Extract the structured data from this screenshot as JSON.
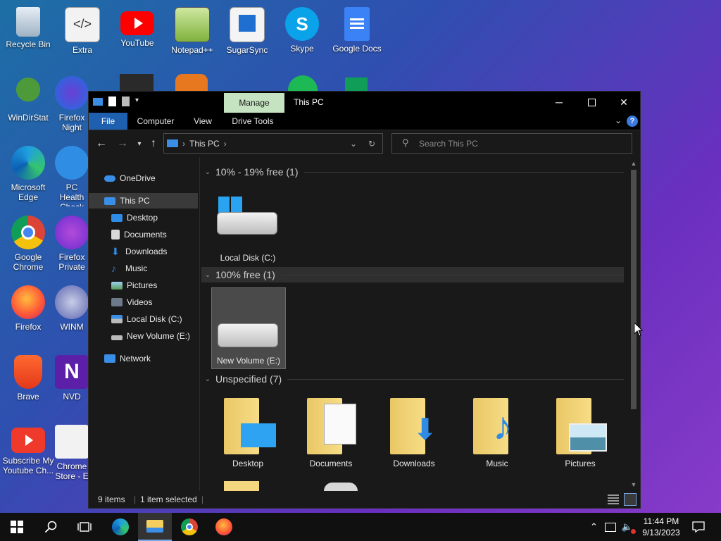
{
  "desktop": {
    "icons": [
      {
        "label": "Recycle Bin"
      },
      {
        "label": "Extra"
      },
      {
        "label": "YouTube"
      },
      {
        "label": "Notepad++"
      },
      {
        "label": "SugarSync"
      },
      {
        "label": "Skype"
      },
      {
        "label": "Google Docs"
      },
      {
        "label": "WinDirStat"
      },
      {
        "label": "Firefox Night"
      },
      {
        "label": "Microsoft Edge"
      },
      {
        "label": "PC Health Check"
      },
      {
        "label": "Google Chrome"
      },
      {
        "label": "Firefox Private"
      },
      {
        "label": "Firefox"
      },
      {
        "label": "WINM"
      },
      {
        "label": "Brave"
      },
      {
        "label": "NVD"
      },
      {
        "label": "Subscribe My Youtube Ch..."
      },
      {
        "label": "Chrome Store - E"
      }
    ]
  },
  "window": {
    "manage_tab": "Manage",
    "title": "This PC",
    "ribbon_tabs": [
      "File",
      "Computer",
      "View",
      "Drive Tools"
    ],
    "address": "This PC",
    "search_placeholder": "Search This PC",
    "nav": {
      "onedrive": "OneDrive",
      "thispc": "This PC",
      "desktop": "Desktop",
      "documents": "Documents",
      "downloads": "Downloads",
      "music": "Music",
      "pictures": "Pictures",
      "videos": "Videos",
      "localdisk": "Local Disk (C:)",
      "newvolume": "New Volume (E:)",
      "network": "Network"
    },
    "groups": {
      "g1": "10% - 19% free (1)",
      "g2": "100% free (1)",
      "g3": "Unspecified (7)"
    },
    "tiles": {
      "localdisk": "Local Disk (C:)",
      "newvolume": "New Volume (E:)",
      "desktop": "Desktop",
      "documents": "Documents",
      "downloads": "Downloads",
      "music": "Music",
      "pictures": "Pictures"
    },
    "status": {
      "items": "9 items",
      "selected": "1 item selected"
    }
  },
  "taskbar": {
    "time": "11:44 PM",
    "date": "9/13/2023"
  }
}
